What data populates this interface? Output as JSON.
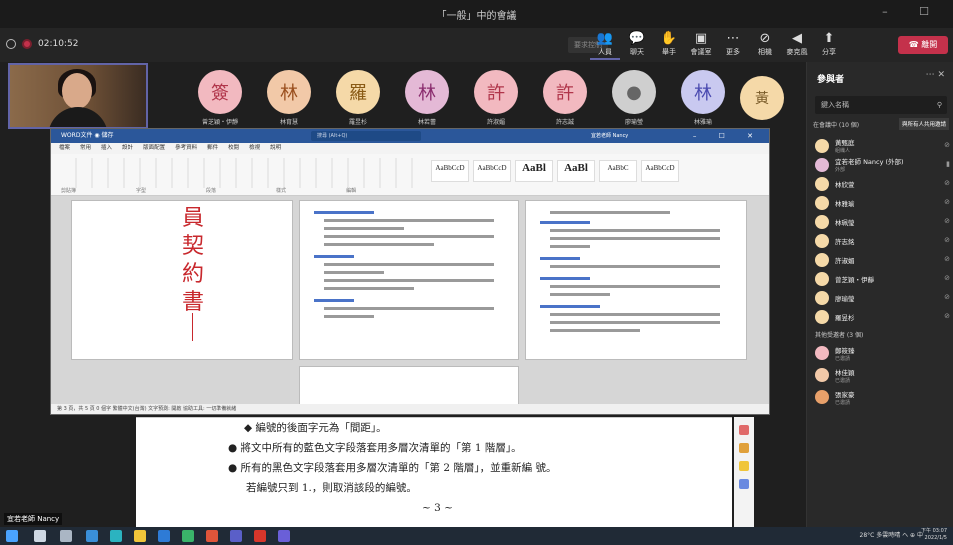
{
  "window": {
    "title": "「一般」中的會議",
    "controls": "– ☐"
  },
  "meeting": {
    "timer": "02:10:52",
    "join_label": "要求控制",
    "actions": [
      {
        "label": "人員",
        "icon": "people"
      },
      {
        "label": "聊天",
        "icon": "chat"
      },
      {
        "label": "舉手",
        "icon": "hand"
      },
      {
        "label": "會議室",
        "icon": "rooms"
      },
      {
        "label": "更多",
        "icon": "more"
      },
      {
        "label": "相機",
        "icon": "camera"
      },
      {
        "label": "麥克風",
        "icon": "mic"
      },
      {
        "label": "分享",
        "icon": "share"
      }
    ],
    "leave_label": "離開",
    "presenter_name": "宜若老師 Nancy"
  },
  "participants": [
    {
      "initial": "簽",
      "name": "曾芝穎・伊靜",
      "bg": "#f2b9c0",
      "fg": "#b0354a"
    },
    {
      "initial": "林",
      "name": "林育慧",
      "bg": "#f2c9a8",
      "fg": "#9a4f1e"
    },
    {
      "initial": "羅",
      "name": "羅昱杉",
      "bg": "#f5d9a8",
      "fg": "#8a5b16"
    },
    {
      "initial": "林",
      "name": "林若蕾",
      "bg": "#e4b9d6",
      "fg": "#8a2c6e"
    },
    {
      "initial": "許",
      "name": "許淑媚",
      "bg": "#f2b9c0",
      "fg": "#b0354a"
    },
    {
      "initial": "許",
      "name": "許志誠",
      "bg": "#f2b9c0",
      "fg": "#b0354a"
    },
    {
      "initial": "",
      "name": "廖瑜瑩",
      "bg": "#cfcfcf",
      "fg": "#666"
    },
    {
      "initial": "林",
      "name": "林雅瑜",
      "bg": "#c9c9f0",
      "fg": "#4a4ab0"
    }
  ],
  "ghost_initial": "黃",
  "word": {
    "title": "WORD文件 ◉ 儲存",
    "search_placeholder": "搜尋 (Alt+Q)",
    "user": "宜若老師 Nancy",
    "menu": [
      "檔案",
      "常用",
      "插入",
      "設計",
      "版面配置",
      "參考資料",
      "郵件",
      "校閱",
      "檢視",
      "說明"
    ],
    "styles": [
      "AaBbCcD",
      "AaBbCcD",
      "AaBl",
      "AaBl",
      "AaBbC",
      "AaBbCcD"
    ],
    "groups": [
      "剪貼簿",
      "字型",
      "段落",
      "樣式",
      "編輯"
    ],
    "cover_title": "員契約書",
    "status": "第 3 頁，共 5 頁  0 個字  繁體中文(台灣)  文字預測: 開啟  協助工具: 一切準備就緒"
  },
  "document": {
    "lines": [
      "◆  編號的後面字元為「間距」。",
      "● 將文中所有的藍色文字段落套用多層次清單的「第 1 階層」。",
      "● 所有的黑色文字段落套用多層次清單的「第 2 階層」，並重新編 號。",
      "若編號只到 1.，則取消該段的編號。",
      "~ 3 ~"
    ]
  },
  "panel": {
    "title": "參與者",
    "search_placeholder": "鍵入名稱",
    "section_in_meeting": "在會議中 (10 個)",
    "section_others": "其他受邀者 (3 個)",
    "share_invite": "與所有人共用邀請",
    "in_meeting": [
      {
        "name": "黃甄庭",
        "sub": "組織人",
        "bg": "#f5d9a8"
      },
      {
        "name": "宜若老師 Nancy (外部)",
        "sub": "外部",
        "bg": "#e4b9d6"
      },
      {
        "name": "林欣萱",
        "sub": "",
        "bg": "#f5d9a8"
      },
      {
        "name": "林雅瑜",
        "sub": "",
        "bg": "#f5d9a8"
      },
      {
        "name": "林珮瑩",
        "sub": "",
        "bg": "#f5d9a8"
      },
      {
        "name": "許志銘",
        "sub": "",
        "bg": "#f5d9a8"
      },
      {
        "name": "許淑媚",
        "sub": "",
        "bg": "#f5d9a8"
      },
      {
        "name": "曾芝穎・伊靜",
        "sub": "",
        "bg": "#f5d9a8"
      },
      {
        "name": "廖瑜瑩",
        "sub": "",
        "bg": "#f5d9a8"
      },
      {
        "name": "羅昱杉",
        "sub": "",
        "bg": "#f5d9a8"
      }
    ],
    "others": [
      {
        "name": "鄭筱臻",
        "sub": "已邀請",
        "bg": "#f2b9c0"
      },
      {
        "name": "林佳穎",
        "sub": "已邀請",
        "bg": "#f2c9a8"
      },
      {
        "name": "張家豪",
        "sub": "已邀請",
        "bg": "#e8a06a"
      }
    ]
  },
  "taskbar": {
    "tray": "28°C 多雲時晴  ヘ  ⊕  中",
    "time": "下午 03:07",
    "date": "2022/1/5"
  }
}
